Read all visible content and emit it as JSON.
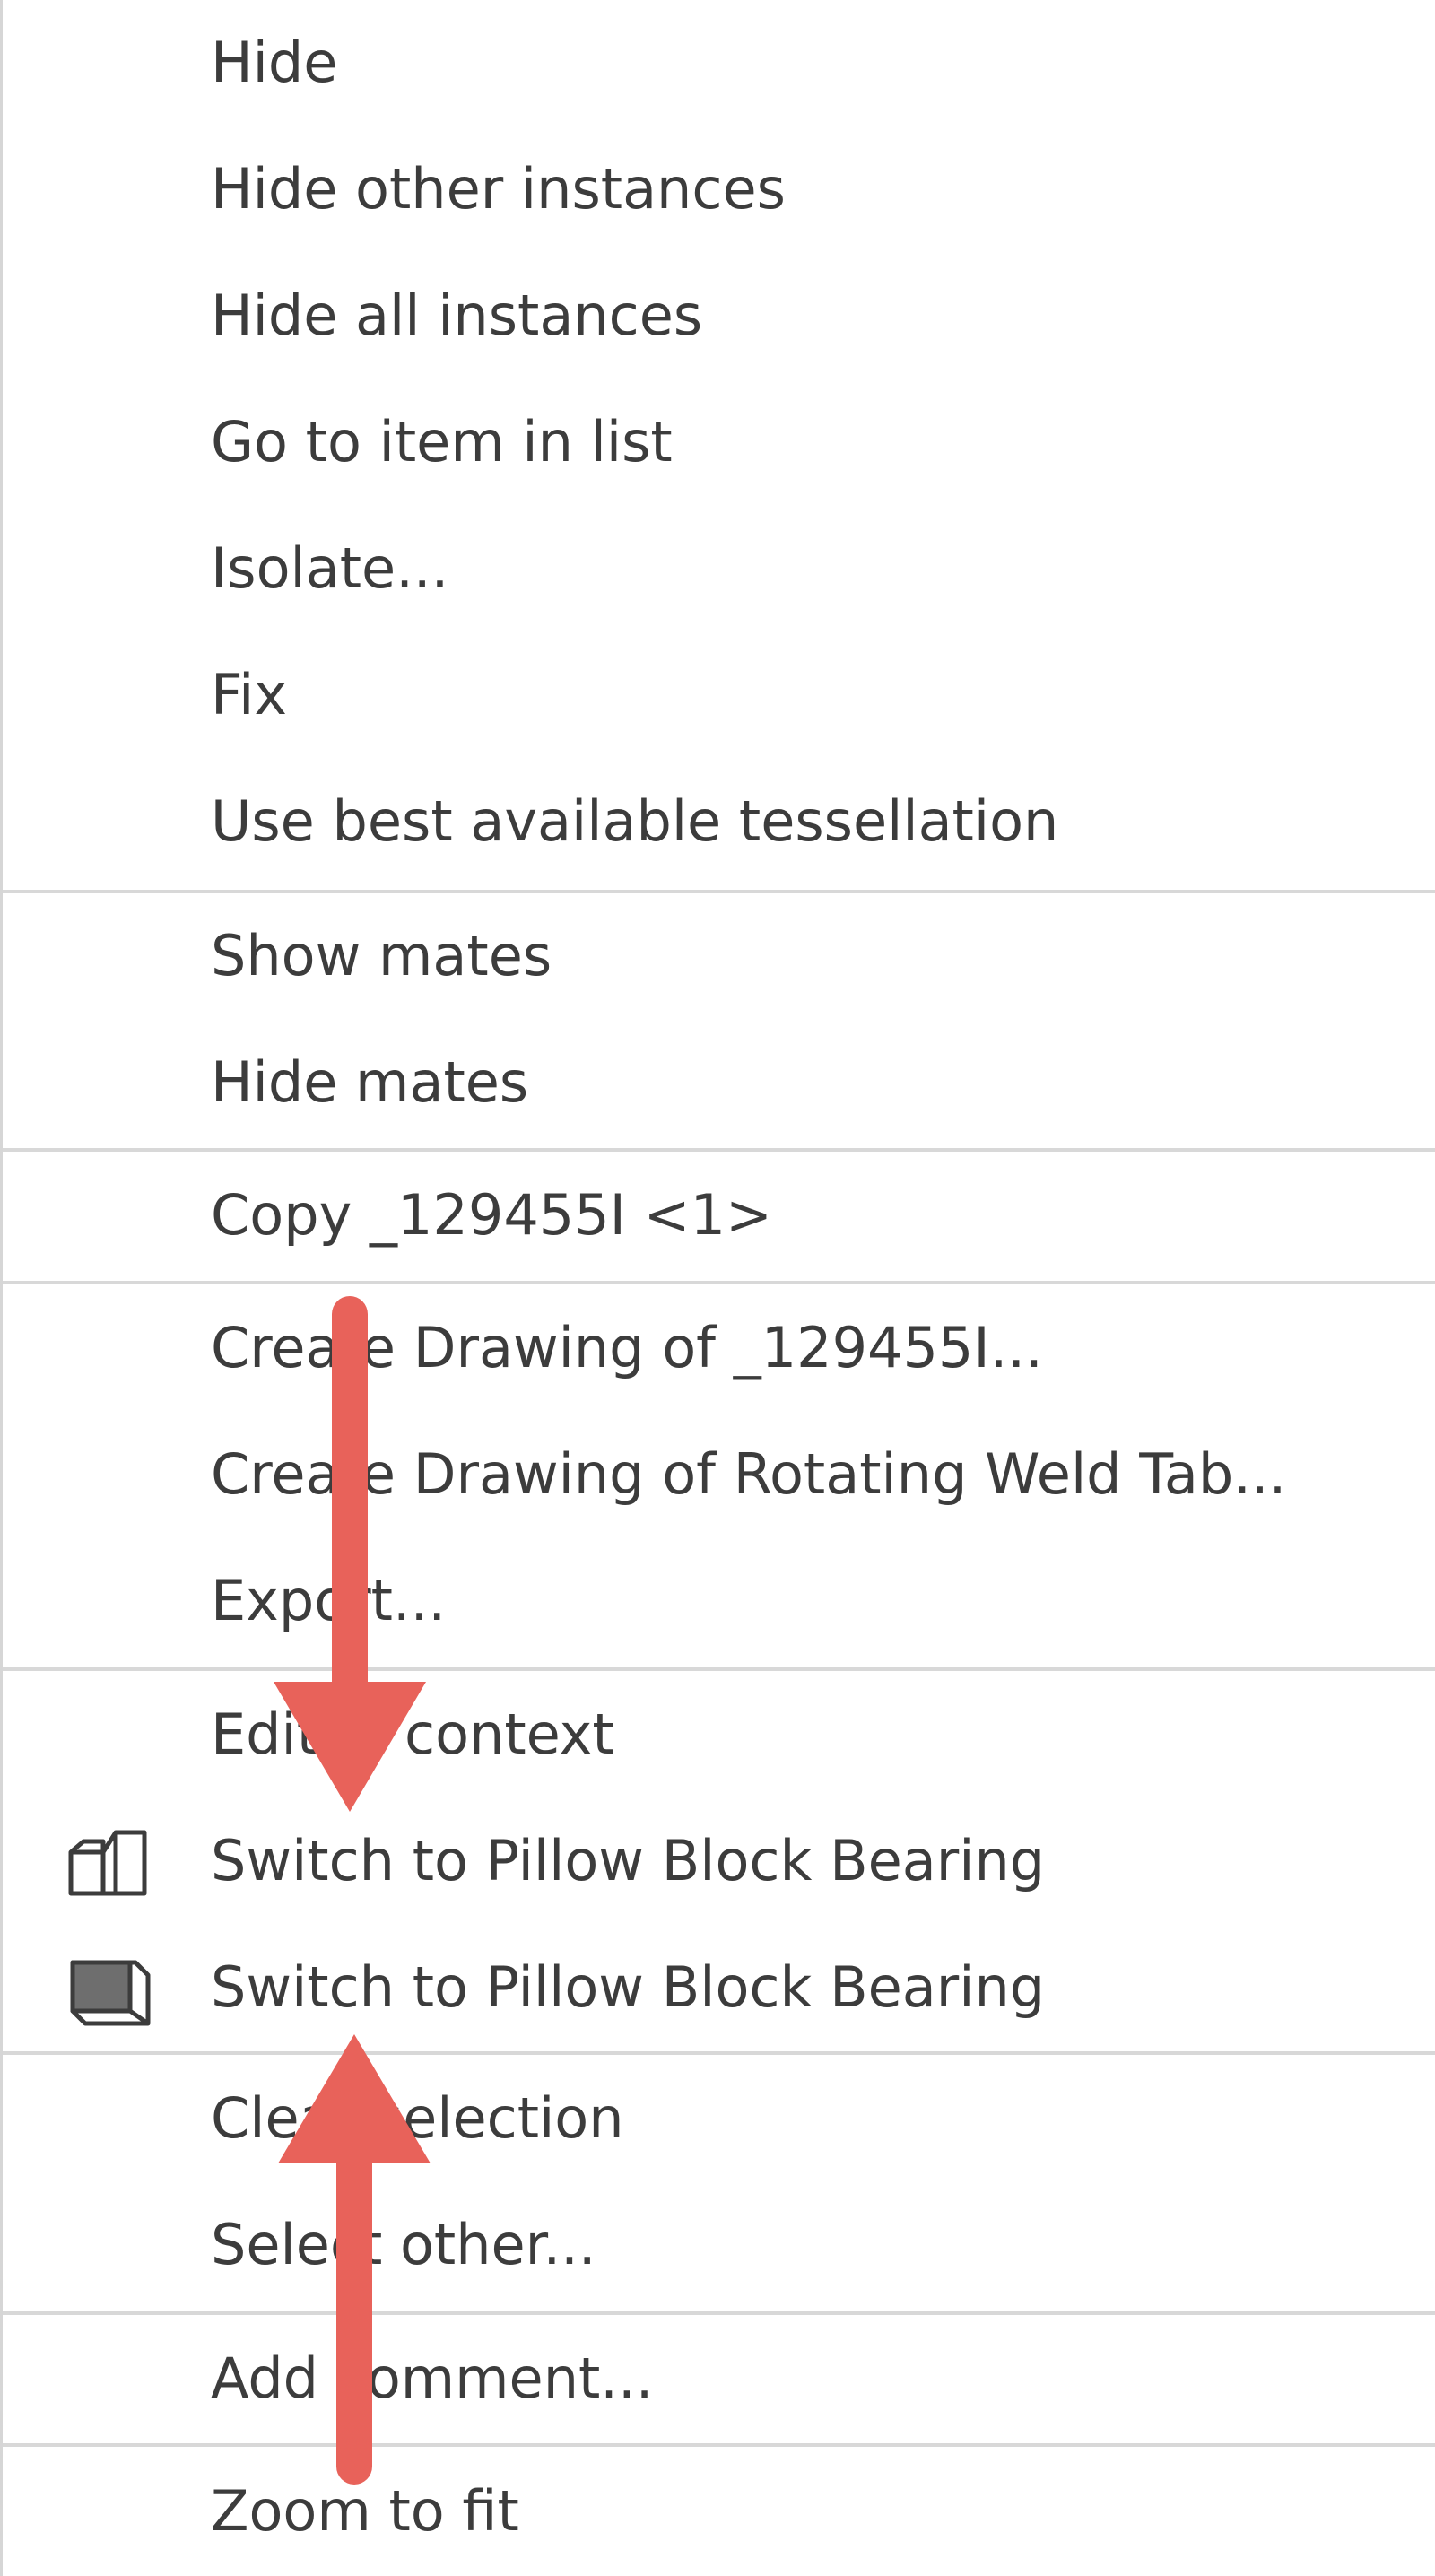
{
  "menu": {
    "items": [
      {
        "label": "Hide"
      },
      {
        "label": "Hide other instances"
      },
      {
        "label": "Hide all instances"
      },
      {
        "label": "Go to item in list"
      },
      {
        "label": "Isolate..."
      },
      {
        "label": "Fix"
      },
      {
        "label": "Use best available tessellation"
      },
      {
        "label": "Show mates"
      },
      {
        "label": "Hide mates"
      },
      {
        "label": "Copy _129455I <1>"
      },
      {
        "label": "Create Drawing of _129455I..."
      },
      {
        "label": "Create Drawing of Rotating Weld Tab..."
      },
      {
        "label": "Export..."
      },
      {
        "label": "Edit in context"
      },
      {
        "label": "Switch to Pillow Block Bearing",
        "icon": "part-outline-icon"
      },
      {
        "label": "Switch to Pillow Block Bearing",
        "icon": "part-solid-icon"
      },
      {
        "label": "Clear selection"
      },
      {
        "label": "Select other..."
      },
      {
        "label": "Add comment..."
      },
      {
        "label": "Zoom to fit"
      }
    ]
  },
  "annotation": {
    "arrow_color": "#e8625a"
  }
}
